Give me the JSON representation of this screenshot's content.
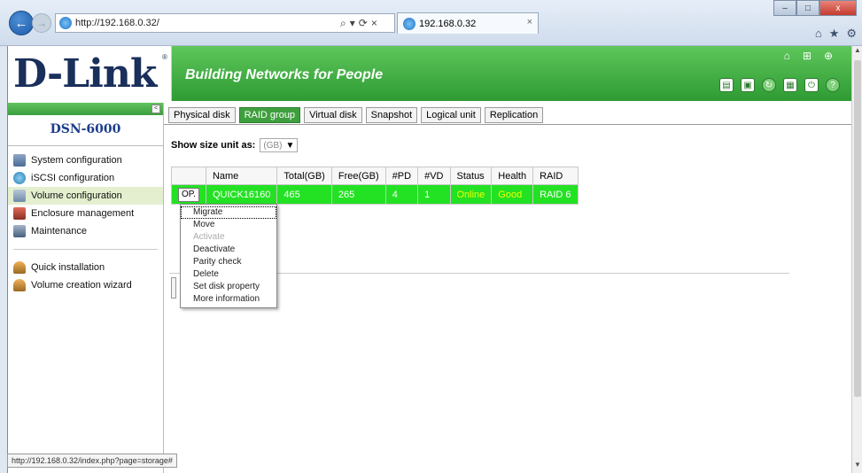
{
  "browser": {
    "url": "http://192.168.0.32/",
    "tab_title": "192.168.0.32",
    "tab_close": "×",
    "addr_tools": [
      "⌕",
      "▾",
      "⟳",
      "×"
    ],
    "status_url": "http://192.168.0.32/index.php?page=storage#",
    "window_controls": [
      "–",
      "□",
      "x"
    ],
    "chrome_icons": [
      "⌂",
      "★",
      "⚙"
    ]
  },
  "header": {
    "logo": "D-Link",
    "logo_reg": "®",
    "tagline": "Building Networks for People",
    "top_icons": [
      "⌂",
      "⊞",
      "⊕"
    ],
    "tool_icons": [
      "disk-icon",
      "chip-icon",
      "refresh-icon",
      "panel-icon",
      "power-icon",
      "help-icon"
    ]
  },
  "sidebar": {
    "collapse": "<",
    "model": "DSN-6000",
    "items": [
      {
        "label": "System configuration",
        "icon": "system-icon"
      },
      {
        "label": "iSCSI configuration",
        "icon": "globe-icon"
      },
      {
        "label": "Volume configuration",
        "icon": "drive-icon",
        "active": true
      },
      {
        "label": "Enclosure management",
        "icon": "enclosure-icon"
      },
      {
        "label": "Maintenance",
        "icon": "maintenance-icon"
      }
    ],
    "wizards": [
      {
        "label": "Quick installation",
        "icon": "hat-icon"
      },
      {
        "label": "Volume creation wizard",
        "icon": "hat-icon"
      }
    ]
  },
  "content": {
    "subtabs": [
      "Physical disk",
      "RAID group",
      "Virtual disk",
      "Snapshot",
      "Logical unit",
      "Replication"
    ],
    "active_subtab": "RAID group",
    "unit_label": "Show size unit as:",
    "unit_value": "(GB)",
    "table": {
      "columns": [
        "",
        "Name",
        "Total(GB)",
        "Free(GB)",
        "#PD",
        "#VD",
        "Status",
        "Health",
        "RAID"
      ],
      "rows": [
        {
          "op": "OP.",
          "name": "QUICK16160",
          "total": "465",
          "free": "265",
          "pd": "4",
          "vd": "1",
          "status": "Online",
          "health": "Good",
          "raid": "RAID 6"
        }
      ]
    },
    "context_menu": [
      "Migrate",
      "Move",
      "Activate",
      "Deactivate",
      "Parity check",
      "Delete",
      "Set disk property",
      "More information"
    ],
    "colors": {
      "row_ok": "#23e123",
      "status_text": "#f0ff00",
      "active_tab": "#3f9f3f"
    }
  }
}
